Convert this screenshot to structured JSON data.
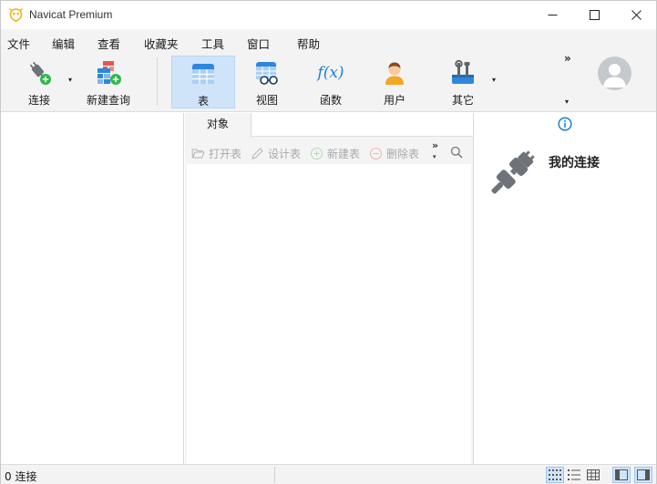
{
  "window": {
    "title": "Navicat Premium",
    "controls": {
      "minimize": "—",
      "maximize": "☐",
      "close": "✕"
    }
  },
  "menu": [
    "文件",
    "编辑",
    "查看",
    "收藏夹",
    "工具",
    "窗口",
    "帮助"
  ],
  "toolbar": {
    "connection_label": "连接",
    "new_query_label": "新建查询",
    "table_label": "表",
    "view_label": "视图",
    "function_label": "函数",
    "user_label": "用户",
    "others_label": "其它",
    "more": "»",
    "dropdown": "▾",
    "function_icon_text": "f(x)"
  },
  "object_tab": {
    "label": "对象"
  },
  "object_toolbar": {
    "open_table": "打开表",
    "design_table": "设计表",
    "new_table": "新建表",
    "delete_table": "删除表",
    "more": "»",
    "dropdown": "▾"
  },
  "right_panel": {
    "title": "我的连接",
    "info": "i"
  },
  "status": {
    "connections_text": "0 连接"
  },
  "colors": {
    "accent": "#1e7fd6",
    "active_tab_bg": "#cfe4f9",
    "plug_gray": "#6d7378",
    "green_add": "#2db84a",
    "disabled_text": "#a8a8a8"
  },
  "icons": {
    "app": "navicat-logo-icon",
    "connect": "plug-add-icon",
    "new_query": "new-query-icon",
    "table": "table-icon",
    "view": "view-icon",
    "function": "function-icon",
    "user": "user-icon",
    "others": "tools-icon",
    "avatar": "avatar-icon",
    "info": "info-icon",
    "connection": "plug-icon",
    "search": "search-icon"
  }
}
